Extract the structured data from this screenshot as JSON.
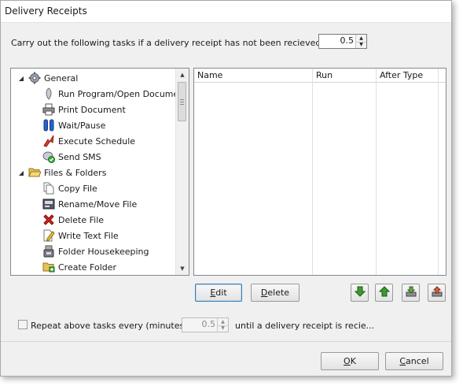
{
  "window": {
    "title": "Delivery Receipts"
  },
  "top_prompt": {
    "label": "Carry out the following tasks if a delivery receipt has not been recieved in (mins)",
    "value": "0.5"
  },
  "tree": {
    "groups": [
      {
        "label": "General",
        "icon": "gear-icon",
        "items": [
          {
            "label": "Run Program/Open Document",
            "icon": "program-icon"
          },
          {
            "label": "Print Document",
            "icon": "printer-icon"
          },
          {
            "label": "Wait/Pause",
            "icon": "pause-icon"
          },
          {
            "label": "Execute Schedule",
            "icon": "schedule-icon"
          },
          {
            "label": "Send SMS",
            "icon": "sms-icon"
          }
        ]
      },
      {
        "label": "Files & Folders",
        "icon": "folder-open-icon",
        "items": [
          {
            "label": "Copy File",
            "icon": "copy-file-icon"
          },
          {
            "label": "Rename/Move File",
            "icon": "rename-file-icon"
          },
          {
            "label": "Delete File",
            "icon": "delete-icon"
          },
          {
            "label": "Write Text File",
            "icon": "write-text-icon"
          },
          {
            "label": "Folder Housekeeping",
            "icon": "housekeeping-icon"
          },
          {
            "label": "Create Folder",
            "icon": "create-folder-icon"
          }
        ]
      }
    ]
  },
  "grid": {
    "columns": [
      "Name",
      "Run",
      "After Type"
    ],
    "rows": []
  },
  "buttons": {
    "edit": {
      "mnemonic": "E",
      "rest": "dit"
    },
    "delete": {
      "mnemonic": "D",
      "rest": "elete"
    },
    "ok": {
      "mnemonic": "O",
      "rest": "K"
    },
    "cancel": {
      "mnemonic": "C",
      "rest": "ancel"
    }
  },
  "order_buttons": [
    {
      "name": "move-down",
      "icon": "arrow-down-icon",
      "color": "#3c9a2e"
    },
    {
      "name": "move-up",
      "icon": "arrow-up-icon",
      "color": "#3c9a2e"
    },
    {
      "name": "import",
      "icon": "import-icon",
      "color": "#7a8a6a"
    },
    {
      "name": "export",
      "icon": "export-icon",
      "color": "#d0553a"
    }
  ],
  "repeat": {
    "checked": false,
    "label": "Repeat above tasks every (minutes)",
    "value": "0.5",
    "suffix": "until a delivery receipt is recie..."
  }
}
